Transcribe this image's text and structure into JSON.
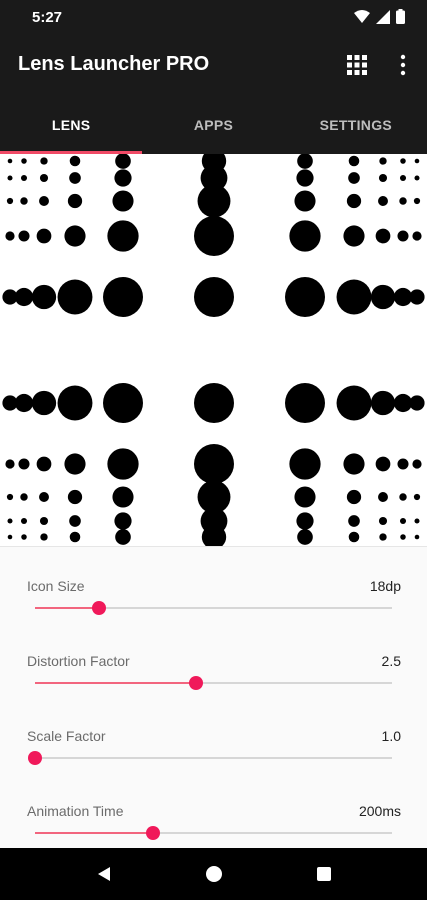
{
  "status_bar": {
    "time": "5:27"
  },
  "app_bar": {
    "title": "Lens Launcher PRO",
    "actions": [
      "grid-icon",
      "more-vert-icon"
    ]
  },
  "tabs": [
    {
      "label": "LENS",
      "active": true
    },
    {
      "label": "APPS",
      "active": false
    },
    {
      "label": "SETTINGS",
      "active": false
    }
  ],
  "settings": [
    {
      "label": "Icon Size",
      "value": "18dp",
      "level": 0.18
    },
    {
      "label": "Distortion Factor",
      "value": "2.5",
      "level": 0.45
    },
    {
      "label": "Scale Factor",
      "value": "1.0",
      "level": 0.0
    },
    {
      "label": "Animation Time",
      "value": "200ms",
      "level": 0.33
    }
  ],
  "colors": {
    "accent": "#f0195a",
    "track_fill": "#f2657e",
    "tab_indicator": "#f04a66",
    "bar": "#1a1a1a"
  },
  "nav_bar": {
    "buttons": [
      "back-icon",
      "home-icon",
      "recents-icon"
    ]
  }
}
